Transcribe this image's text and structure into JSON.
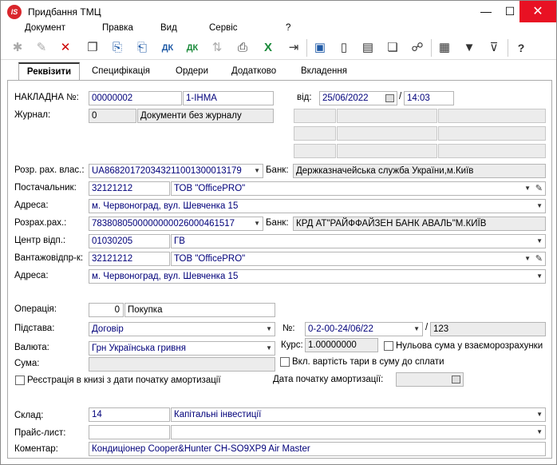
{
  "window": {
    "title": "Придбання ТМЦ",
    "app_icon": "IS",
    "minimize": "—",
    "maximize": "☐",
    "close": "✕"
  },
  "menu": [
    "Документ",
    "Правка",
    "Вид",
    "Сервіс",
    "?"
  ],
  "tabs": [
    "Реквізити",
    "Специфікація",
    "Ордери",
    "Додатково",
    "Вкладення"
  ],
  "form": {
    "invoice_label": "НАКЛАДНА №:",
    "invoice_number": "00000002",
    "invoice_code": "1-ІНМА",
    "from_label": "від:",
    "date": "25/06/2022",
    "time": "14:03",
    "journal_label": "Журнал:",
    "journal_num": "0",
    "journal_name": "Документи без журналу",
    "account_own_label": "Розр. рах. влас.:",
    "account_own": "UA868201720343211001300013179",
    "bank_label": "Банк:",
    "bank_own": "Держказначейська служба України,м.Київ",
    "supplier_label": "Постачальник:",
    "supplier_code": "32121212",
    "supplier_name": "ТОВ \"OfficePRO\"",
    "address_label": "Адреса:",
    "address": "м. Червоноград, вул. Шевченка 15",
    "account_label": "Розрах.рах.:",
    "account": "7838080500000000026000461517",
    "bank_label2": "Банк:",
    "bank": "КРД АТ\"РАЙФФАЙЗЕН БАНК АВАЛЬ\"М.КИЇВ",
    "center_label": "Центр відп.:",
    "center_code": "01030205",
    "center_name": "ГВ",
    "shipper_label": "Вантажовідпр-к:",
    "shipper_code": "32121212",
    "shipper_name": "ТОВ \"OfficePRO\"",
    "address2_label": "Адреса:",
    "address2": "м. Червоноград, вул. Шевченка 15",
    "operation_label": "Операція:",
    "operation_num": "0",
    "operation_name": "Покупка",
    "basis_label": "Підстава:",
    "basis": "Договір",
    "no_label": "№:",
    "basis_number": "0-2-00-24/06/22",
    "basis_number2": "123",
    "currency_label": "Валюта:",
    "currency": "Грн Українська гривня",
    "rate_label": "Курс:",
    "rate": "1.00000000",
    "zero_sum_label": "Нульова сума у взаєморозрахунки",
    "sum_label": "Сума:",
    "tare_label": "Вкл. вартість тари в суму до сплати",
    "registration_label": "Реєстрація в книзі з дати початку амортизації",
    "amort_date_label": "Дата початку амортизації:",
    "warehouse_label": "Склад:",
    "warehouse_num": "14",
    "warehouse_name": "Капітальні інвестиції",
    "pricelist_label": "Прайс-лист:",
    "comment_label": "Коментар:",
    "comment": "Кондиціонер Cooper&Hunter CH-SO9XP9 Air Master"
  }
}
